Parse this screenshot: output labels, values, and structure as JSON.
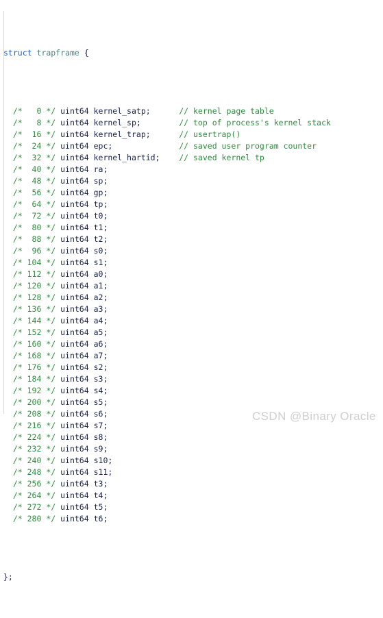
{
  "editor": {
    "language": "c",
    "colors": {
      "background": "#ffffff",
      "keyword": "#1f5fbf",
      "type_name": "#4e8080",
      "punctuation": "#1a1f4b",
      "type": "#16214d",
      "identifier": "#16214d",
      "comment": "#2e8b3d",
      "indent_guide": "#d8d8d8",
      "watermark": "#cfcfcf"
    },
    "header": {
      "keyword": "struct",
      "type_name": "trapframe",
      "brace": "{"
    },
    "footer": {
      "text": "};"
    },
    "field_type": "uint64",
    "fields": [
      {
        "offset": "0",
        "name": "kernel_satp",
        "comment": "// kernel page table"
      },
      {
        "offset": "8",
        "name": "kernel_sp",
        "comment": "// top of process's kernel stack"
      },
      {
        "offset": "16",
        "name": "kernel_trap",
        "comment": "// usertrap()"
      },
      {
        "offset": "24",
        "name": "epc",
        "comment": "// saved user program counter"
      },
      {
        "offset": "32",
        "name": "kernel_hartid",
        "comment": "// saved kernel tp"
      },
      {
        "offset": "40",
        "name": "ra",
        "comment": ""
      },
      {
        "offset": "48",
        "name": "sp",
        "comment": ""
      },
      {
        "offset": "56",
        "name": "gp",
        "comment": ""
      },
      {
        "offset": "64",
        "name": "tp",
        "comment": ""
      },
      {
        "offset": "72",
        "name": "t0",
        "comment": ""
      },
      {
        "offset": "80",
        "name": "t1",
        "comment": ""
      },
      {
        "offset": "88",
        "name": "t2",
        "comment": ""
      },
      {
        "offset": "96",
        "name": "s0",
        "comment": ""
      },
      {
        "offset": "104",
        "name": "s1",
        "comment": ""
      },
      {
        "offset": "112",
        "name": "a0",
        "comment": ""
      },
      {
        "offset": "120",
        "name": "a1",
        "comment": ""
      },
      {
        "offset": "128",
        "name": "a2",
        "comment": ""
      },
      {
        "offset": "136",
        "name": "a3",
        "comment": ""
      },
      {
        "offset": "144",
        "name": "a4",
        "comment": ""
      },
      {
        "offset": "152",
        "name": "a5",
        "comment": ""
      },
      {
        "offset": "160",
        "name": "a6",
        "comment": ""
      },
      {
        "offset": "168",
        "name": "a7",
        "comment": ""
      },
      {
        "offset": "176",
        "name": "s2",
        "comment": ""
      },
      {
        "offset": "184",
        "name": "s3",
        "comment": ""
      },
      {
        "offset": "192",
        "name": "s4",
        "comment": ""
      },
      {
        "offset": "200",
        "name": "s5",
        "comment": ""
      },
      {
        "offset": "208",
        "name": "s6",
        "comment": ""
      },
      {
        "offset": "216",
        "name": "s7",
        "comment": ""
      },
      {
        "offset": "224",
        "name": "s8",
        "comment": ""
      },
      {
        "offset": "232",
        "name": "s9",
        "comment": ""
      },
      {
        "offset": "240",
        "name": "s10",
        "comment": ""
      },
      {
        "offset": "248",
        "name": "s11",
        "comment": ""
      },
      {
        "offset": "256",
        "name": "t3",
        "comment": ""
      },
      {
        "offset": "264",
        "name": "t4",
        "comment": ""
      },
      {
        "offset": "272",
        "name": "t5",
        "comment": ""
      },
      {
        "offset": "280",
        "name": "t6",
        "comment": ""
      }
    ]
  },
  "watermark": {
    "text": "CSDN @Binary Oracle"
  }
}
